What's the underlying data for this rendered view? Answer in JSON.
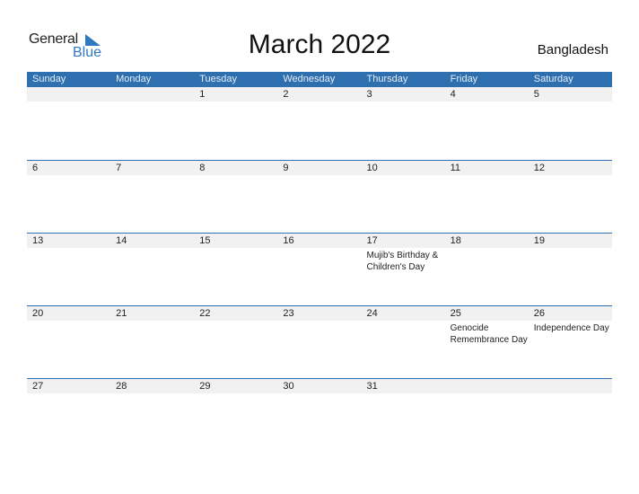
{
  "logo": {
    "general": "General",
    "blue": "Blue"
  },
  "title": "March 2022",
  "country": "Bangladesh",
  "colors": {
    "accent": "#2e6fb0",
    "day_bg": "#f1f1f1"
  },
  "weekdays": [
    "Sunday",
    "Monday",
    "Tuesday",
    "Wednesday",
    "Thursday",
    "Friday",
    "Saturday"
  ],
  "weeks": [
    [
      {
        "d": ""
      },
      {
        "d": ""
      },
      {
        "d": "1"
      },
      {
        "d": "2"
      },
      {
        "d": "3"
      },
      {
        "d": "4"
      },
      {
        "d": "5"
      }
    ],
    [
      {
        "d": "6"
      },
      {
        "d": "7"
      },
      {
        "d": "8"
      },
      {
        "d": "9"
      },
      {
        "d": "10"
      },
      {
        "d": "11"
      },
      {
        "d": "12"
      }
    ],
    [
      {
        "d": "13"
      },
      {
        "d": "14"
      },
      {
        "d": "15"
      },
      {
        "d": "16"
      },
      {
        "d": "17",
        "e": "Mujib's Birthday & Children's Day"
      },
      {
        "d": "18"
      },
      {
        "d": "19"
      }
    ],
    [
      {
        "d": "20"
      },
      {
        "d": "21"
      },
      {
        "d": "22"
      },
      {
        "d": "23"
      },
      {
        "d": "24"
      },
      {
        "d": "25",
        "e": "Genocide Remembrance Day"
      },
      {
        "d": "26",
        "e": "Independence Day"
      }
    ],
    [
      {
        "d": "27"
      },
      {
        "d": "28"
      },
      {
        "d": "29"
      },
      {
        "d": "30"
      },
      {
        "d": "31"
      },
      {
        "d": ""
      },
      {
        "d": ""
      }
    ]
  ]
}
